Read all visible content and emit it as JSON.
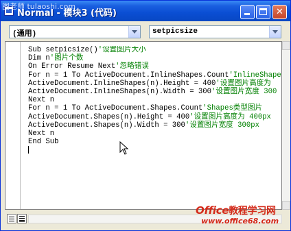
{
  "window": {
    "watermark": "图老师 tulaoshi.com",
    "title": "Normal - 模块3 (代码)"
  },
  "title_buttons": {
    "minimize": "",
    "maximize": "",
    "close": "✕"
  },
  "combos": {
    "object": "(通用)",
    "procedure": "setpicsize"
  },
  "code_lines": [
    {
      "code": "Sub setpicsize()",
      "comment": "'设置图片大小"
    },
    {
      "code": "Dim n",
      "comment": "'图片个数"
    },
    {
      "code": "On Error Resume Next",
      "comment": "'忽略错误"
    },
    {
      "code": "For n = 1 To ActiveDocument.InlineShapes.Count",
      "comment": "'InlineShapes"
    },
    {
      "code": "ActiveDocument.InlineShapes(n).Height = 400",
      "comment": "'设置图片高度为"
    },
    {
      "code": "ActiveDocument.InlineShapes(n).Width = 300",
      "comment": "'设置图片宽度 300"
    },
    {
      "code": "Next n",
      "comment": ""
    },
    {
      "code": "For n = 1 To ActiveDocument.Shapes.Count",
      "comment": "'Shapes类型图片"
    },
    {
      "code": "ActiveDocument.Shapes(n).Height = 400",
      "comment": "'设置图片高度为 400px"
    },
    {
      "code": "ActiveDocument.Shapes(n).Width = 300",
      "comment": "'设置图片宽度 300px"
    },
    {
      "code": "Next n",
      "comment": ""
    },
    {
      "code": "End Sub",
      "comment": ""
    }
  ],
  "logo": {
    "brand_latin": "Office",
    "brand_cn": "教程学习网",
    "url": "www.office68.com"
  },
  "colors": {
    "titlebar": "#0a4ed3",
    "comment": "#008000",
    "logo": "#d42a1a"
  }
}
